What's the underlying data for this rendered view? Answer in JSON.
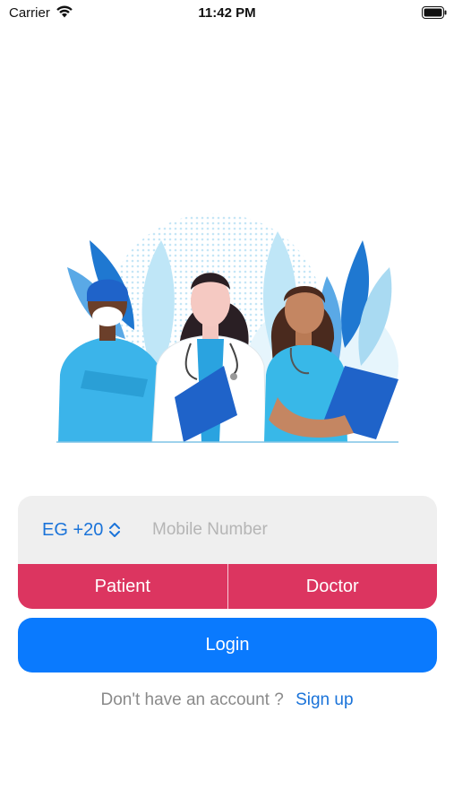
{
  "status_bar": {
    "carrier": "Carrier",
    "time": "11:42 PM",
    "wifi_icon": "wifi-icon",
    "battery_icon": "battery-icon"
  },
  "hero": {
    "illustration": "medical-staff-illustration",
    "figures": [
      "surgeon",
      "doctor",
      "nurse"
    ]
  },
  "login_form": {
    "country_code": "EG +20",
    "country_icon": "chevron-up-down-icon",
    "mobile_placeholder": "Mobile Number",
    "mobile_value": "",
    "roles": [
      "Patient",
      "Doctor"
    ],
    "login_label": "Login"
  },
  "signup": {
    "prompt": "Don't have an account ?",
    "link": "Sign up"
  },
  "colors": {
    "accent_blue": "#0a7afe",
    "link_blue": "#1a73d9",
    "role_pink": "#dc3560",
    "card_gray": "#efefef"
  }
}
